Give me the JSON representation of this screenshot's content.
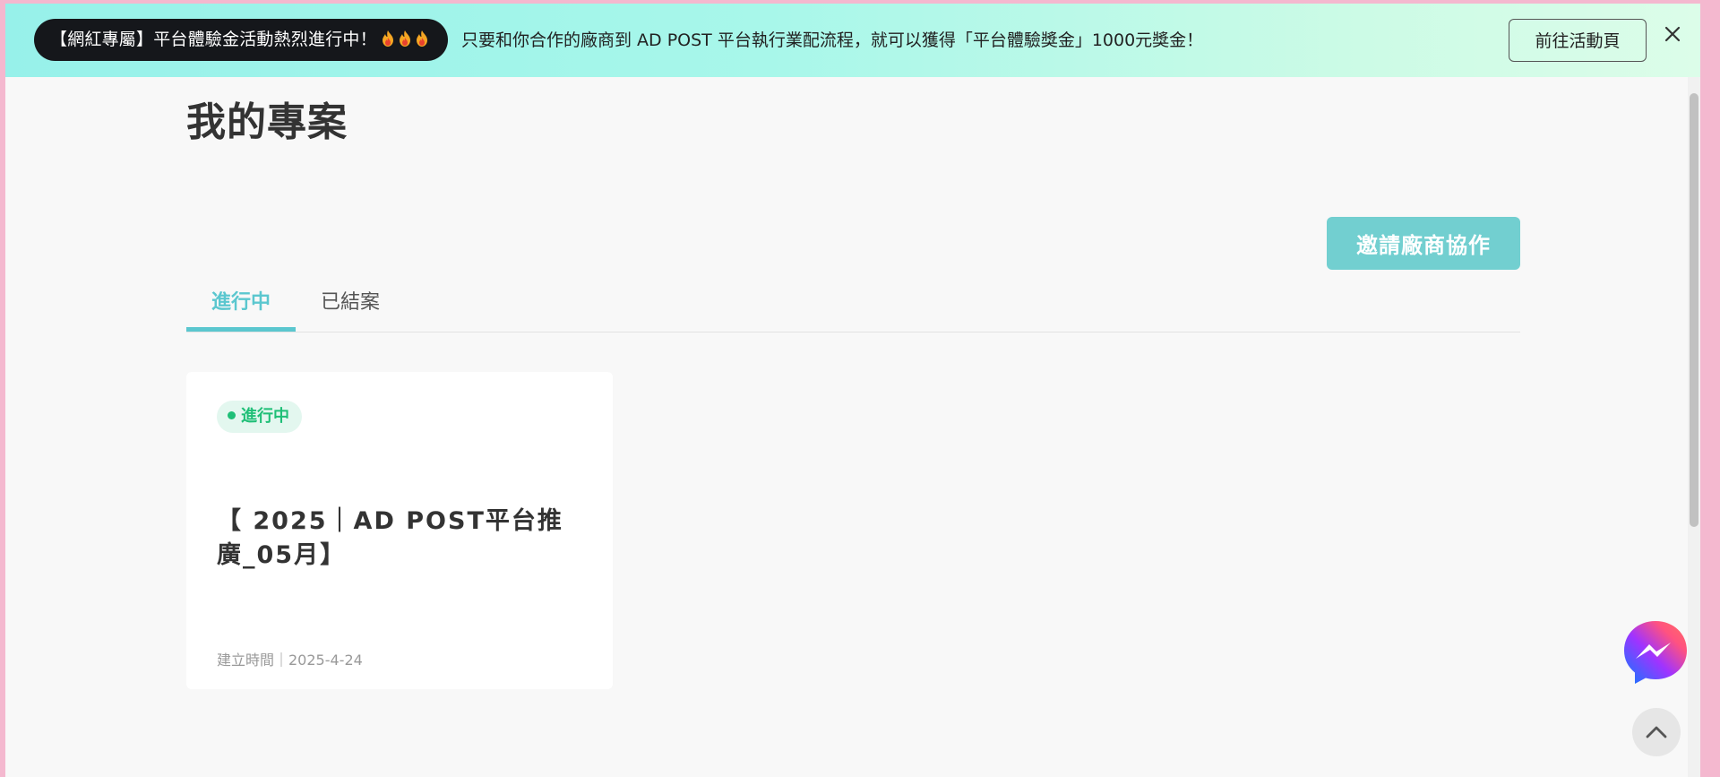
{
  "banner": {
    "pill_text": "【網紅專屬】平台體驗金活動熱烈進行中！",
    "pill_icons": [
      "fire-icon",
      "fire-icon",
      "fire-icon"
    ],
    "message": "只要和你合作的廠商到 AD POST 平台執行業配流程，就可以獲得「平台體驗獎金」1000元獎金！",
    "button_label": "前往活動頁",
    "close_icon": "close-icon",
    "colors": {
      "gradient_start": "#97f1ea",
      "gradient_end": "#dcfde9",
      "pill_bg": "#15171b"
    }
  },
  "main": {
    "title": "我的專案",
    "invite_button": "邀請廠商協作",
    "tabs": [
      {
        "label": "進行中",
        "active": true
      },
      {
        "label": "已結案",
        "active": false
      }
    ],
    "projects": [
      {
        "status": "進行中",
        "title": "【 2025｜AD POST平台推廣_05月】",
        "created": "建立時間｜2025-4-24"
      }
    ]
  },
  "floating": {
    "messenger_icon": "messenger-icon",
    "back_to_top_icon": "chevron-up-icon"
  },
  "colors": {
    "accent": "#5bc7cf",
    "invite_button": "#72cfd0",
    "status_green": "#1fbf77",
    "status_bg": "#e3f7ef",
    "page_bg": "#f8f8f8",
    "frame": "#f4b8cf"
  }
}
